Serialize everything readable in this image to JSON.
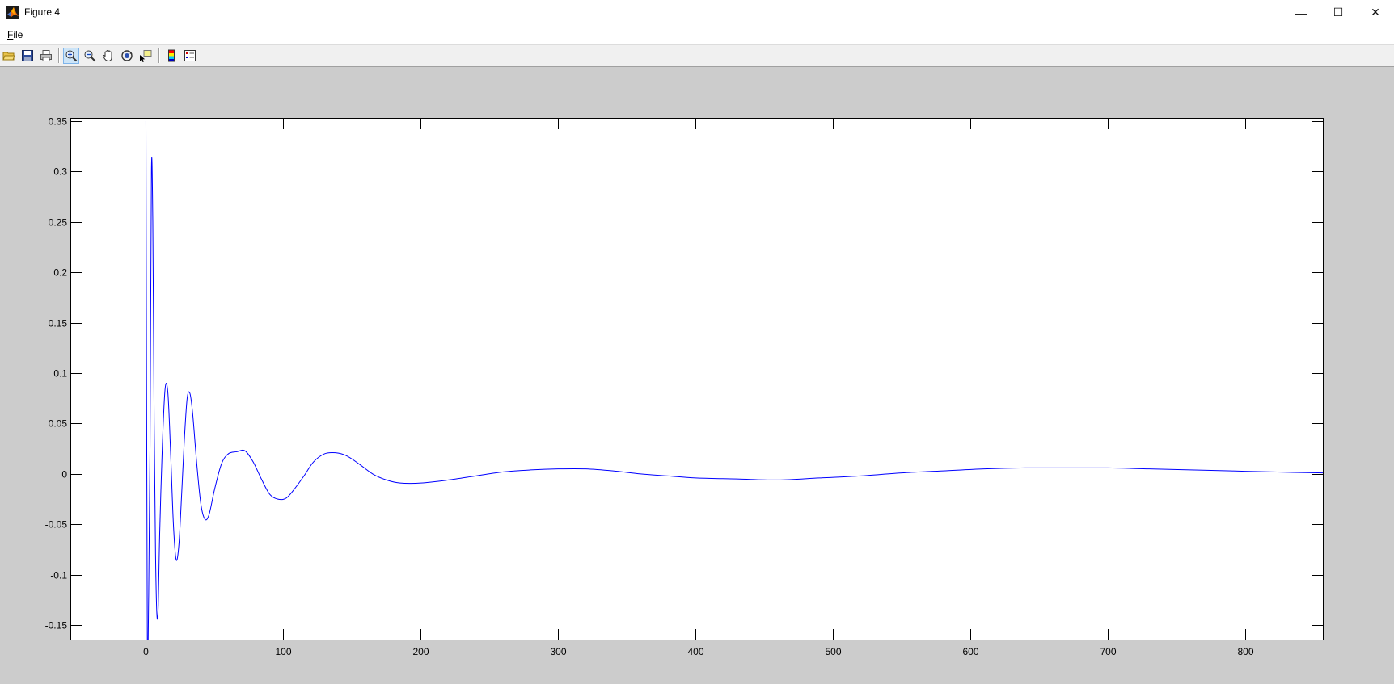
{
  "window": {
    "title": "Figure 4",
    "minimize_glyph": "—",
    "maximize_glyph": "☐",
    "close_glyph": "✕"
  },
  "menu": {
    "file_mnemonic": "F",
    "file_rest": "ile"
  },
  "toolbar": {
    "items": [
      {
        "name": "open-file-icon"
      },
      {
        "name": "save-icon"
      },
      {
        "name": "print-icon"
      },
      {
        "name": "zoom-in-icon",
        "active": true
      },
      {
        "name": "zoom-out-icon"
      },
      {
        "name": "pan-hand-icon"
      },
      {
        "name": "rotate-3d-icon"
      },
      {
        "name": "data-cursor-icon"
      },
      {
        "name": "colorbar-icon"
      },
      {
        "name": "legend-icon"
      }
    ]
  },
  "colors": {
    "line": "#0000ff",
    "figure_bg": "#cccccc",
    "axes_bg": "#ffffff"
  },
  "chart_data": {
    "type": "line",
    "title": "",
    "xlabel": "",
    "ylabel": "",
    "xlim": [
      -55,
      857
    ],
    "ylim": [
      -0.165,
      0.353
    ],
    "xticks": [
      0,
      100,
      200,
      300,
      400,
      500,
      600,
      700,
      800
    ],
    "yticks": [
      -0.15,
      -0.1,
      -0.05,
      0,
      0.05,
      0.1,
      0.15,
      0.2,
      0.25,
      0.3,
      0.35
    ],
    "xtick_labels": [
      "0",
      "100",
      "200",
      "300",
      "400",
      "500",
      "600",
      "700",
      "800"
    ],
    "ytick_labels": [
      "-0.15",
      "-0.1",
      "-0.05",
      "0",
      "0.05",
      "0.1",
      "0.15",
      "0.2",
      "0.25",
      "0.3",
      "0.35"
    ],
    "grid": false,
    "legend": "none",
    "series": [
      {
        "color": "#0000ff",
        "x": [
          0,
          1,
          2,
          3,
          4,
          5,
          6,
          7,
          8,
          9,
          10,
          12,
          14,
          16,
          18,
          20,
          22,
          24,
          26,
          28,
          30,
          32,
          34,
          37,
          40,
          43,
          46,
          50,
          55,
          60,
          66,
          72,
          78,
          84,
          90,
          96,
          102,
          108,
          115,
          122,
          130,
          138,
          146,
          155,
          165,
          175,
          185,
          200,
          220,
          240,
          260,
          280,
          300,
          320,
          340,
          360,
          380,
          400,
          430,
          460,
          490,
          520,
          550,
          580,
          610,
          640,
          670,
          700,
          730,
          760,
          790,
          820,
          857
        ],
        "y": [
          0.35,
          -0.16,
          -0.12,
          0.03,
          0.3,
          0.25,
          0.05,
          -0.08,
          -0.14,
          -0.13,
          -0.06,
          0.03,
          0.085,
          0.08,
          0.02,
          -0.05,
          -0.085,
          -0.07,
          -0.02,
          0.035,
          0.075,
          0.08,
          0.06,
          0.01,
          -0.03,
          -0.045,
          -0.04,
          -0.015,
          0.01,
          0.02,
          0.022,
          0.023,
          0.012,
          -0.005,
          -0.02,
          -0.025,
          -0.024,
          -0.015,
          -0.002,
          0.012,
          0.02,
          0.021,
          0.018,
          0.01,
          0.0,
          -0.006,
          -0.009,
          -0.009,
          -0.006,
          -0.002,
          0.002,
          0.004,
          0.005,
          0.005,
          0.003,
          0.0,
          -0.002,
          -0.004,
          -0.005,
          -0.006,
          -0.004,
          -0.002,
          0.001,
          0.003,
          0.005,
          0.006,
          0.006,
          0.006,
          0.005,
          0.004,
          0.003,
          0.002,
          0.001
        ]
      }
    ]
  }
}
